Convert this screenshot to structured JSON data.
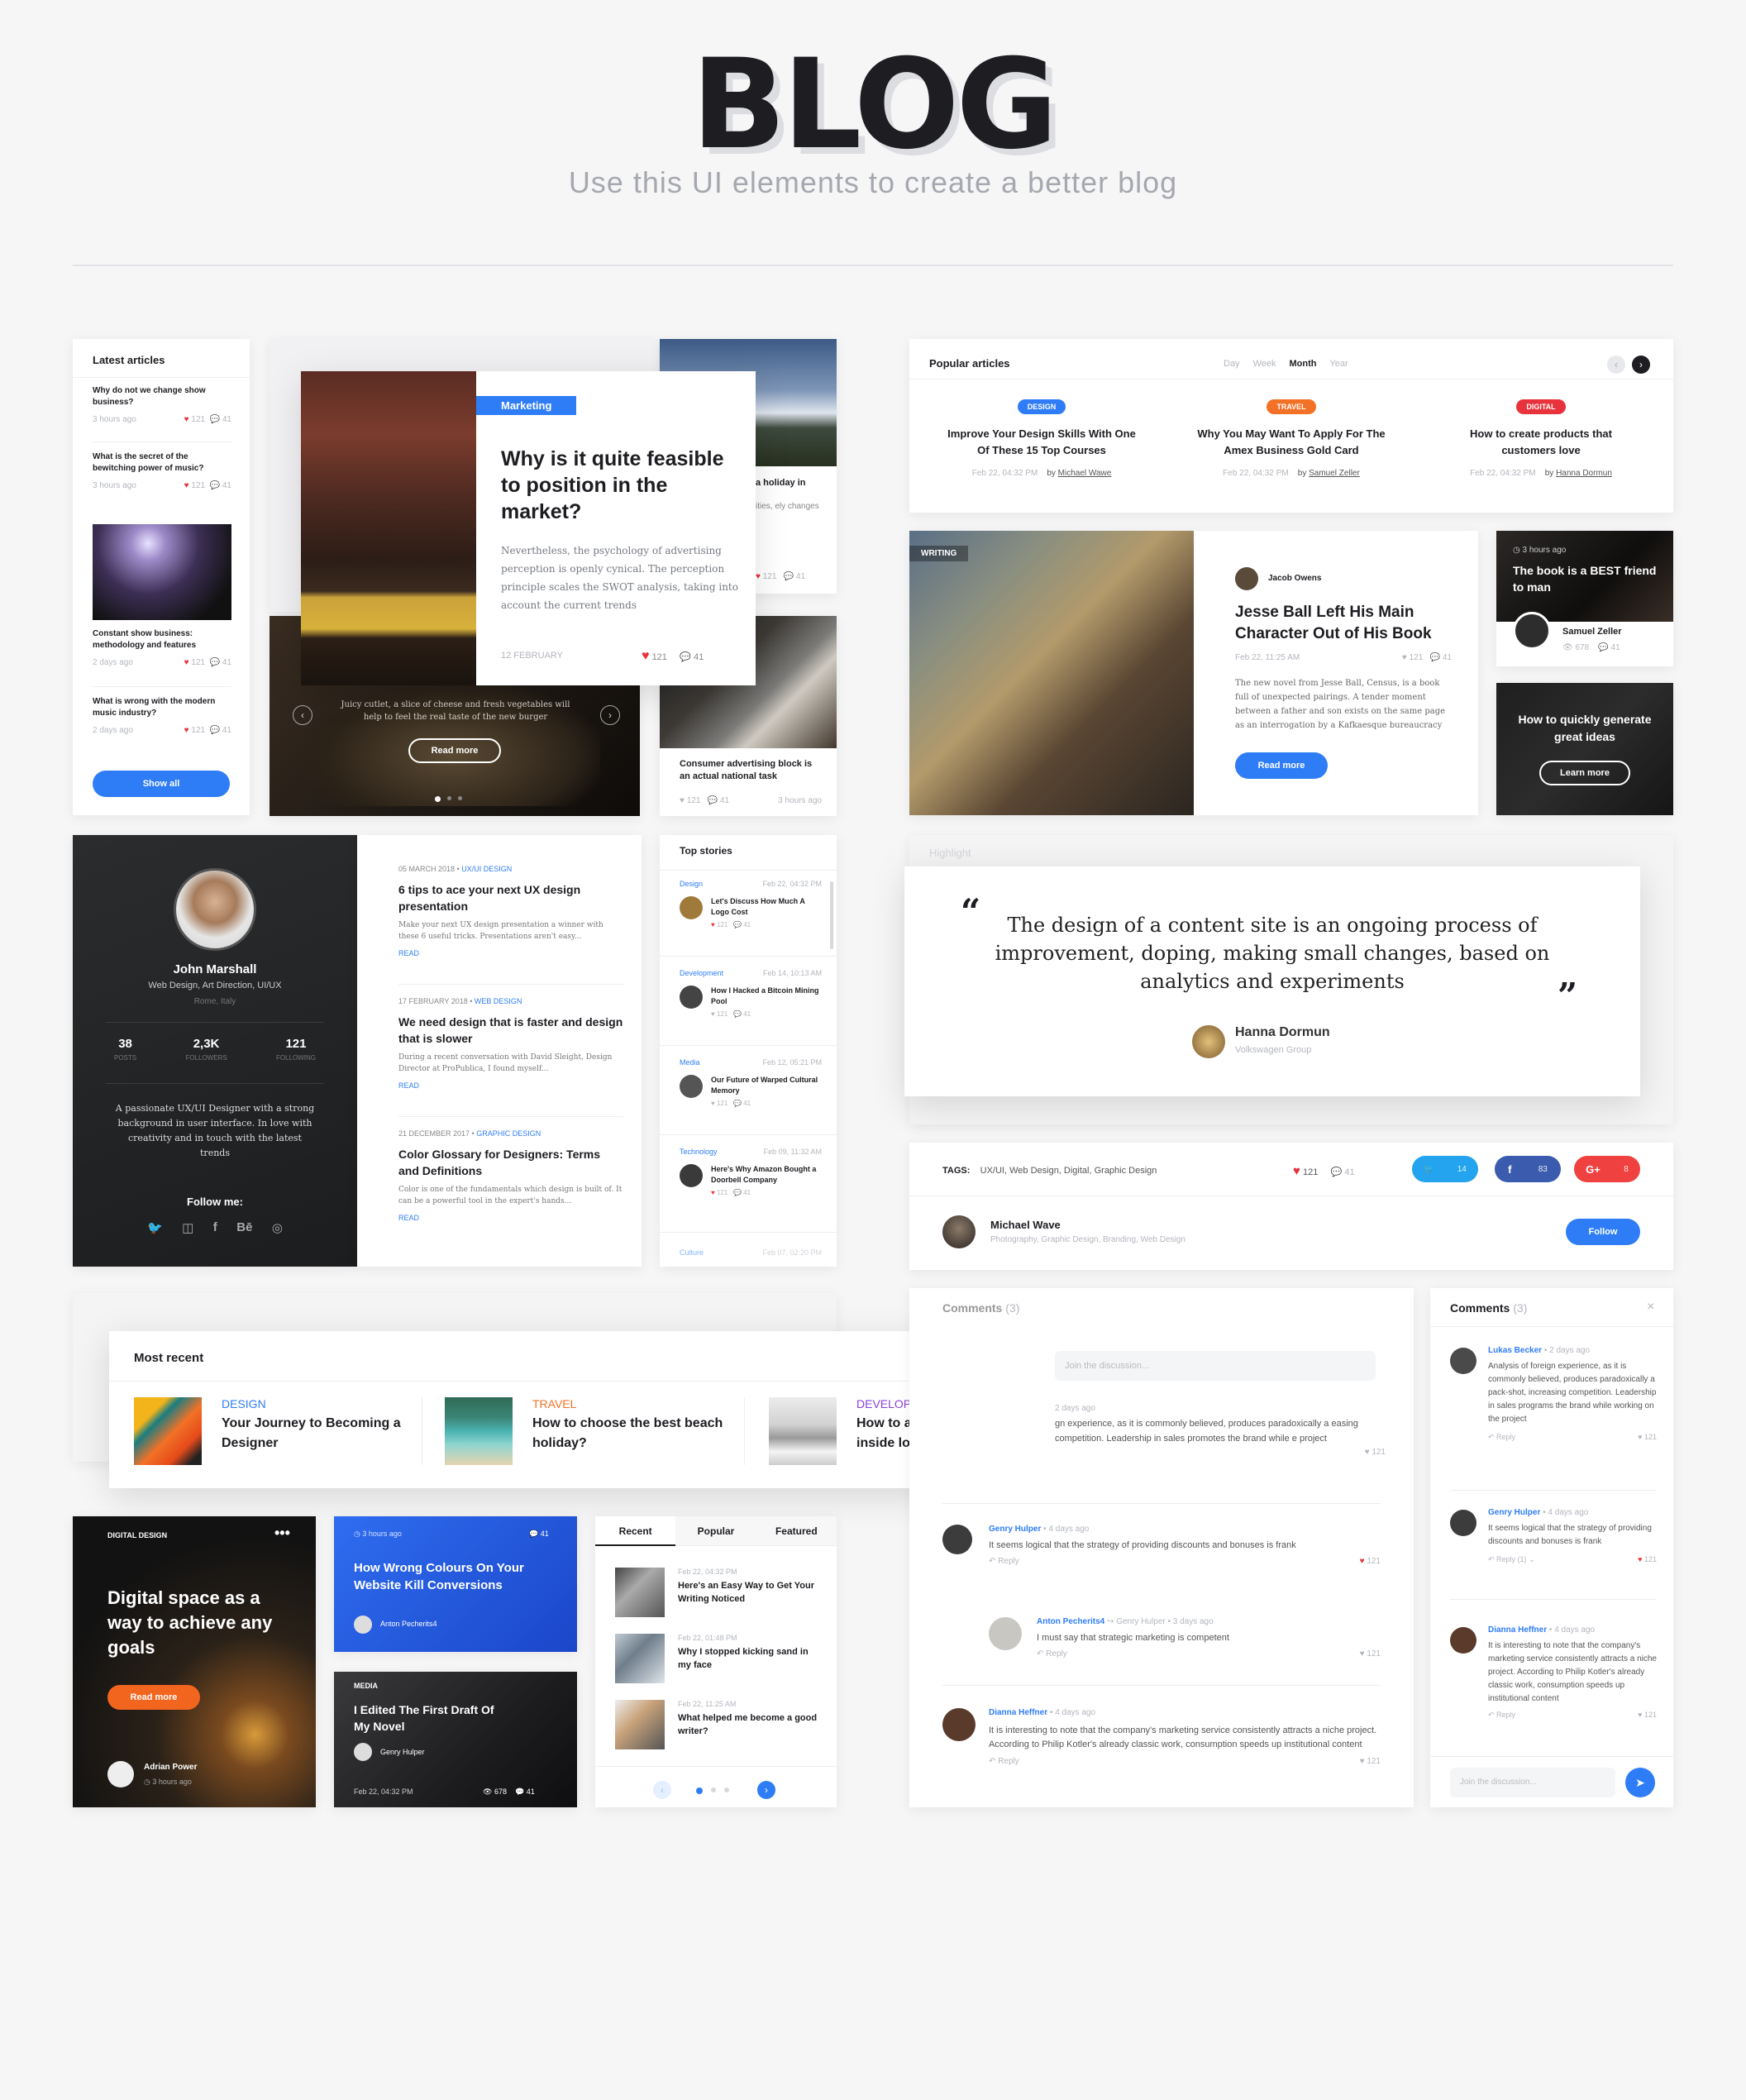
{
  "header": {
    "title": "BLOG",
    "subtitle": "Use this UI elements to create a better blog"
  },
  "latest": {
    "title": "Latest articles",
    "items": [
      {
        "title": "Why do not we change show business?",
        "time": "3 hours ago",
        "likes": "121",
        "comments": "41"
      },
      {
        "title": "What is the secret of the bewitching power of music?",
        "time": "3 hours ago",
        "likes": "121",
        "comments": "41"
      },
      {
        "title": "Constant show business: methodology and features",
        "time": "2 days ago",
        "likes": "121",
        "comments": "41"
      },
      {
        "title": "What is wrong with the modern music industry?",
        "time": "2 days ago",
        "likes": "121",
        "comments": "41"
      }
    ],
    "button": "Show all"
  },
  "featured": {
    "tag": "Marketing",
    "title": "Why is it quite feasible to position in the market?",
    "body": "Nevertheless, the psychology of advertising perception is openly cynical. The perception principle scales the SWOT analysis, taking into account the current trends",
    "date": "12 FEBRUARY",
    "likes": "121",
    "comments": "41"
  },
  "slider": {
    "text": "Juicy cutlet, a slice of cheese and fresh vegetables will help to feel the real taste of the new burger",
    "button": "Read more"
  },
  "mountain": {
    "title": "a holiday in",
    "body": "ities, ely changes",
    "likes": "121",
    "comments": "41"
  },
  "newspaper": {
    "title": "Consumer advertising block is an actual national task",
    "likes": "121",
    "comments": "41",
    "time": "3 hours ago"
  },
  "popular": {
    "title": "Popular articles",
    "filters": [
      "Day",
      "Week",
      "Month",
      "Year"
    ],
    "items": [
      {
        "tag": "DESIGN",
        "color": "#2f7df6",
        "title": "Improve Your Design Skills With One Of These 15 Top Courses",
        "date": "Feb 22, 04:32 PM",
        "by": "by",
        "author": "Michael Wawe"
      },
      {
        "tag": "TRAVEL",
        "color": "#f27127",
        "title": "Why You May Want To Apply For The Amex Business Gold Card",
        "date": "Feb 22, 04:32 PM",
        "by": "by",
        "author": "Samuel Zeller"
      },
      {
        "tag": "DIGITAL",
        "color": "#e8323c",
        "title": "How to create products that customers love",
        "date": "Feb 22, 04:32 PM",
        "by": "by",
        "author": "Hanna Dormun"
      }
    ]
  },
  "writing": {
    "tag": "WRITING",
    "author": "Jacob Owens",
    "title": "Jesse Ball Left His Main Character Out of His Book",
    "date": "Feb 22, 11:25 AM",
    "likes": "121",
    "comments": "41",
    "body": "The new novel from Jesse Ball, Census, is a book full of unexpected pairings. A tender moment between a father and son exists on the same page as an interrogation by a Kafkaesque bureaucracy",
    "button": "Read more"
  },
  "bookcard": {
    "time": "3 hours ago",
    "title": "The book is a BEST friend to man",
    "author": "Samuel Zeller",
    "views": "678",
    "comments": "41"
  },
  "ideas": {
    "title": "How to quickly generate great ideas",
    "button": "Learn more"
  },
  "profile": {
    "name": "John Marshall",
    "role": "Web Design, Art Direction, UI/UX",
    "location": "Rome, Italy",
    "stats": [
      {
        "num": "38",
        "label": "POSTS"
      },
      {
        "num": "2,3K",
        "label": "FOLLOWERS"
      },
      {
        "num": "121",
        "label": "FOLLOWING"
      }
    ],
    "bio": "A passionate UX/UI Designer with a strong background in user interface. In love with creativity and in touch with the latest trends",
    "follow": "Follow me:"
  },
  "posts": [
    {
      "date": "05 MARCH 2018",
      "cat": "UX/UI DESIGN",
      "title": "6 tips to ace your next UX design presentation",
      "body": "Make your next UX design presentation a winner with these 6 useful tricks. Presentations aren't easy...",
      "read": "READ"
    },
    {
      "date": "17 FEBRUARY 2018",
      "cat": "WEB DESIGN",
      "title": "We need design that is faster and design that is slower",
      "body": "During a recent conversation with David Sleight, Design Director at ProPublica, I found myself...",
      "read": "READ"
    },
    {
      "date": "21 DECEMBER 2017",
      "cat": "GRAPHIC DESIGN",
      "title": "Color Glossary for Designers: Terms and Definitions",
      "body": "Color is one of the fundamentals which design is built of. It can be a powerful tool in the expert's hands...",
      "read": "READ"
    }
  ],
  "topstories": {
    "title": "Top stories",
    "items": [
      {
        "cat": "Design",
        "date": "Feb 22, 04:32 PM",
        "title": "Let's Discuss How Much A Logo Cost",
        "likes": "121",
        "comments": "41"
      },
      {
        "cat": "Development",
        "date": "Feb 14, 10:13 AM",
        "title": "How I Hacked a Bitcoin Mining Pool",
        "likes": "121",
        "comments": "41"
      },
      {
        "cat": "Media",
        "date": "Feb 12, 05:21 PM",
        "title": "Our Future of Warped Cultural Memory",
        "likes": "121",
        "comments": "41"
      },
      {
        "cat": "Technology",
        "date": "Feb 09, 11:32 AM",
        "title": "Here's Why Amazon Bought a Doorbell Company",
        "likes": "121",
        "comments": "41"
      },
      {
        "cat": "Culture",
        "date": "Feb 07, 02:20 PM"
      }
    ]
  },
  "quote": {
    "ghost": "Highlight",
    "text": "The design of a content site is an ongoing process of improvement, doping, making small changes, based on analytics and experiments",
    "author": "Hanna Dormun",
    "company": "Volkswagen Group"
  },
  "tags": {
    "label": "TAGS:",
    "list": "UX/UI,  Web Design,  Digital,  Graphic Design",
    "likes": "121",
    "comments": "41",
    "twitter": "14",
    "facebook": "83",
    "gplus": "8"
  },
  "authorrow": {
    "name": "Michael Wave",
    "skills": "Photography, Graphic Design, Branding, Web Design",
    "button": "Follow"
  },
  "recent": {
    "title": "Most recent",
    "items": [
      {
        "cat": "DESIGN",
        "color": "#2f7df6",
        "title": "Your Journey to Becoming a Designer"
      },
      {
        "cat": "TRAVEL",
        "color": "#f27127",
        "title": "How to choose the best beach holiday?"
      },
      {
        "cat": "DEVELOPMENT",
        "color": "#8b3fd9",
        "title": "How to avoid SQL queries inside loops?"
      }
    ]
  },
  "digital": {
    "tag": "DIGITAL DESIGN",
    "title": "Digital space as a way to achieve any goals",
    "button": "Read more",
    "author": "Adrian Power",
    "time": "3 hours ago"
  },
  "bluecard": {
    "time": "3 hours ago",
    "comments": "41",
    "title": "How Wrong Colours On Your Website Kill Conversions",
    "author": "Anton Pecherits4"
  },
  "media": {
    "tag": "MEDIA",
    "title": "I Edited The First Draft Of My Novel",
    "author": "Genry Hulper",
    "date": "Feb 22, 04:32 PM",
    "views": "678",
    "comments": "41"
  },
  "tabs": {
    "labels": [
      "Recent",
      "Popular",
      "Featured"
    ],
    "items": [
      {
        "date": "Feb 22, 04:32 PM",
        "title": "Here's an Easy Way to Get Your Writing Noticed"
      },
      {
        "date": "Feb 22, 01:48 PM",
        "title": "Why I stopped kicking sand in my face"
      },
      {
        "date": "Feb 22, 11:25 AM",
        "title": "What helped me become a good writer?"
      }
    ]
  },
  "comments": {
    "title": "Comments",
    "count": "(3)",
    "placeholder": "Join the discussion...",
    "reply": "Reply",
    "replyone": "Reply (1)",
    "c0": {
      "time": "2 days ago",
      "text": "gn experience, as it is commonly believed, produces paradoxically a easing competition. Leadership in sales promotes the brand while e project",
      "likes": "121"
    },
    "c1": {
      "name": "Genry Hulper",
      "time": "4 days ago",
      "text": "It seems logical that the strategy of providing discounts and bonuses is frank",
      "likes": "121"
    },
    "c2": {
      "name": "Anton Pecherits4",
      "to": "Genry Hulper",
      "time": "3 days ago",
      "text": "I must say that strategic marketing is competent",
      "likes": "121"
    },
    "c3": {
      "name": "Dianna Heffner",
      "time": "4 days ago",
      "text": "It is interesting to note that the company's marketing service consistently attracts a niche project. According to Philip Kotler's already classic work, consumption speeds up institutional content",
      "likes": "121"
    }
  },
  "comments2": {
    "title": "Comments",
    "count": "(3)",
    "placeholder": "Join the discussion...",
    "reply": "Reply",
    "replyone": "Reply (1)",
    "c1": {
      "name": "Lukas Becker",
      "time": "2 days ago",
      "text": "Analysis of foreign experience, as it is commonly believed, produces paradoxically a pack-shot, increasing competition. Leadership in sales programs the brand while working on the project",
      "likes": "121"
    },
    "c2": {
      "name": "Genry Hulper",
      "time": "4 days ago",
      "text": "It seems logical that the strategy of providing discounts and bonuses is frank",
      "likes": "121"
    },
    "c3": {
      "name": "Dianna Heffner",
      "time": "4 days ago",
      "text": "It is interesting to note that the company's marketing service consistently attracts a niche project. According to Philip Kotler's already classic work, consumption speeds up institutional content",
      "likes": "121"
    }
  }
}
